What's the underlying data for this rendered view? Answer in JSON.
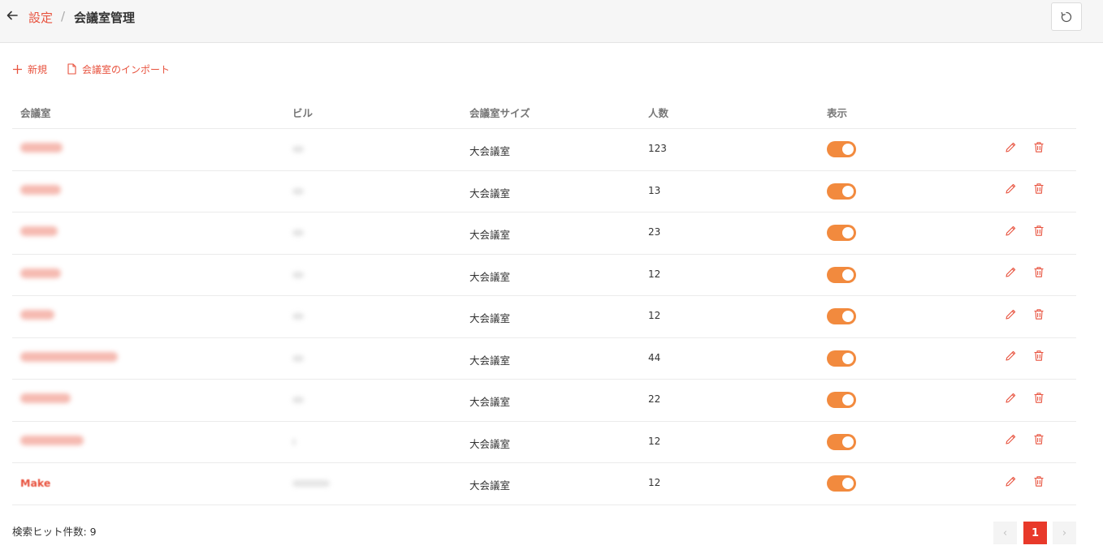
{
  "breadcrumb": {
    "parent": "設定",
    "separator": "/",
    "current": "会議室管理"
  },
  "toolbar": {
    "new_label": "新規",
    "import_label": "会議室のインポート"
  },
  "table": {
    "columns": [
      "会議室",
      "ビル",
      "会議室サイズ",
      "人数",
      "表示"
    ],
    "rows": [
      {
        "size": "大会議室",
        "capacity": "123",
        "display": true
      },
      {
        "size": "大会議室",
        "capacity": "13",
        "display": true
      },
      {
        "size": "大会議室",
        "capacity": "23",
        "display": true
      },
      {
        "size": "大会議室",
        "capacity": "12",
        "display": true
      },
      {
        "size": "大会議室",
        "capacity": "12",
        "display": true
      },
      {
        "size": "大会議室",
        "capacity": "44",
        "display": true
      },
      {
        "size": "大会議室",
        "capacity": "22",
        "display": true
      },
      {
        "size": "大会議室",
        "capacity": "12",
        "display": true
      },
      {
        "name": "Make",
        "size": "大会議室",
        "capacity": "12",
        "display": true
      }
    ]
  },
  "footer": {
    "result_count": "検索ヒット件数: 9"
  },
  "pagination": {
    "current_page": "1",
    "prev_icon": "‹",
    "next_icon": "›"
  },
  "icons": {
    "back": "arrow-left-icon",
    "refresh": "refresh-icon",
    "new": "plus-icon",
    "import": "file-icon",
    "edit": "pencil-icon",
    "delete": "trash-icon"
  },
  "colors": {
    "accent": "#e8533f",
    "toggle_on": "#f28a3e",
    "page_active": "#e8392a",
    "topbar_bg": "#f6f6f6"
  }
}
